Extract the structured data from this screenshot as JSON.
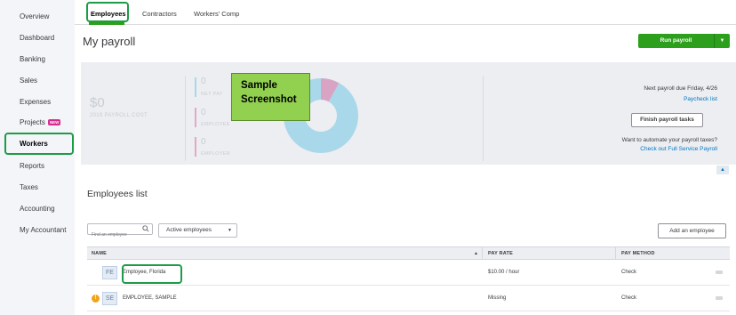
{
  "sidebar": {
    "items": [
      {
        "label": "Overview"
      },
      {
        "label": "Dashboard"
      },
      {
        "label": "Banking"
      },
      {
        "label": "Sales"
      },
      {
        "label": "Expenses"
      },
      {
        "label": "Projects",
        "badge": "NEW"
      },
      {
        "label": "Workers",
        "active": true
      },
      {
        "label": "Reports"
      },
      {
        "label": "Taxes"
      },
      {
        "label": "Accounting"
      },
      {
        "label": "My Accountant"
      }
    ]
  },
  "tabs": [
    {
      "label": "Employees",
      "active": true
    },
    {
      "label": "Contractors"
    },
    {
      "label": "Workers' Comp"
    }
  ],
  "page": {
    "title": "My payroll",
    "run_button": "Run payroll",
    "run_caret": "▼"
  },
  "summary": {
    "cost_amount": "$0",
    "cost_label": "2019 PAYROLL COST",
    "legend": [
      {
        "value": "0",
        "label": "NET PAY",
        "color": "#a8d8ea"
      },
      {
        "value": "0",
        "label": "EMPLOYEE",
        "color": "#e2a9c6"
      },
      {
        "value": "0",
        "label": "EMPLOYER",
        "color": "#e2a9c6"
      }
    ],
    "sample_text": "Sample Screenshot",
    "next_payroll": "Next payroll due Friday, 4/26",
    "paycheck_link": "Paycheck list",
    "finish_button": "Finish payroll tasks",
    "automate_text": "Want to automate your payroll taxes?",
    "fss_link": "Check out Full Service Payroll",
    "donut": {
      "net_pay_fraction": 0.92,
      "net_pay_color": "#a8d8ea",
      "other_color": "#d9a3c4"
    }
  },
  "employees": {
    "title": "Employees list",
    "search_placeholder": "Find an employee",
    "filter_value": "Active employees",
    "add_button": "Add an employee",
    "columns": {
      "name": "NAME",
      "pay_rate": "PAY RATE",
      "pay_method": "PAY METHOD"
    },
    "rows": [
      {
        "initials": "FE",
        "name": "Employee, Florida",
        "pay_rate": "$10.00 / hour",
        "pay_method": "Check",
        "warning": false
      },
      {
        "initials": "SE",
        "name": "EMPLOYEE, SAMPLE",
        "pay_rate": "Missing",
        "pay_method": "Check",
        "warning": true
      }
    ]
  },
  "colors": {
    "accent_green": "#2ca01c",
    "link_blue": "#0077c5",
    "highlight_green": "#1e9b49",
    "sample_green": "#92d050"
  }
}
